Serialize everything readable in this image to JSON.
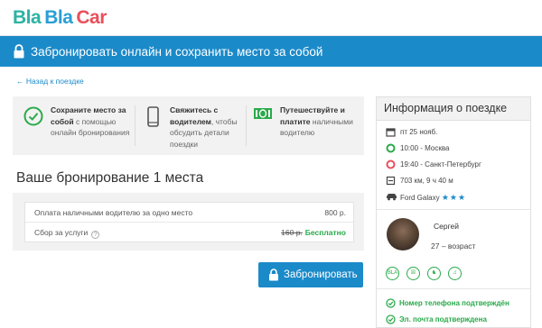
{
  "logo": {
    "part1": "Bla",
    "part2": "Bla",
    "part3": "Car"
  },
  "banner": {
    "text": "Забронировать онлайн и сохранить место за собой"
  },
  "back_link": "← Назад к поездке",
  "features": [
    {
      "bold": "Сохраните место за собой",
      "rest": " с помощью онлайн бронирования"
    },
    {
      "bold": "Свяжитесь с водителем",
      "rest": ", чтобы обсудить детали поездки"
    },
    {
      "bold": "Путешествуйте и платите",
      "rest": " наличными водителю"
    }
  ],
  "booking": {
    "title": "Ваше бронирование 1 места",
    "rows": [
      {
        "label": "Оплата наличными водителю за одно место",
        "value": "800 р."
      },
      {
        "label": "Сбор за услуги",
        "old_value": "160 р.",
        "value": "Бесплатно"
      }
    ],
    "button": "Забронировать"
  },
  "trip": {
    "title": "Информация о поездке",
    "date": "пт 25 нояб.",
    "departure": "10:00 - Москва",
    "arrival": "19:40 - Санкт-Петербург",
    "distance": "703 км, 9 ч 40 м",
    "car": "Ford Galaxy",
    "car_stars": "★★★",
    "driver_name": "Сергей",
    "driver_age": "27 – возраст",
    "pref_labels": [
      "BLA",
      "☒",
      "♞",
      "♫"
    ],
    "verifications": [
      "Номер телефона подтверждён",
      "Эл. почта подтверждена"
    ]
  },
  "colors": {
    "primary": "#1b8ac9",
    "green": "#2aaa4b",
    "logo_red": "#e8505b",
    "logo_teal": "#2db3a4"
  }
}
